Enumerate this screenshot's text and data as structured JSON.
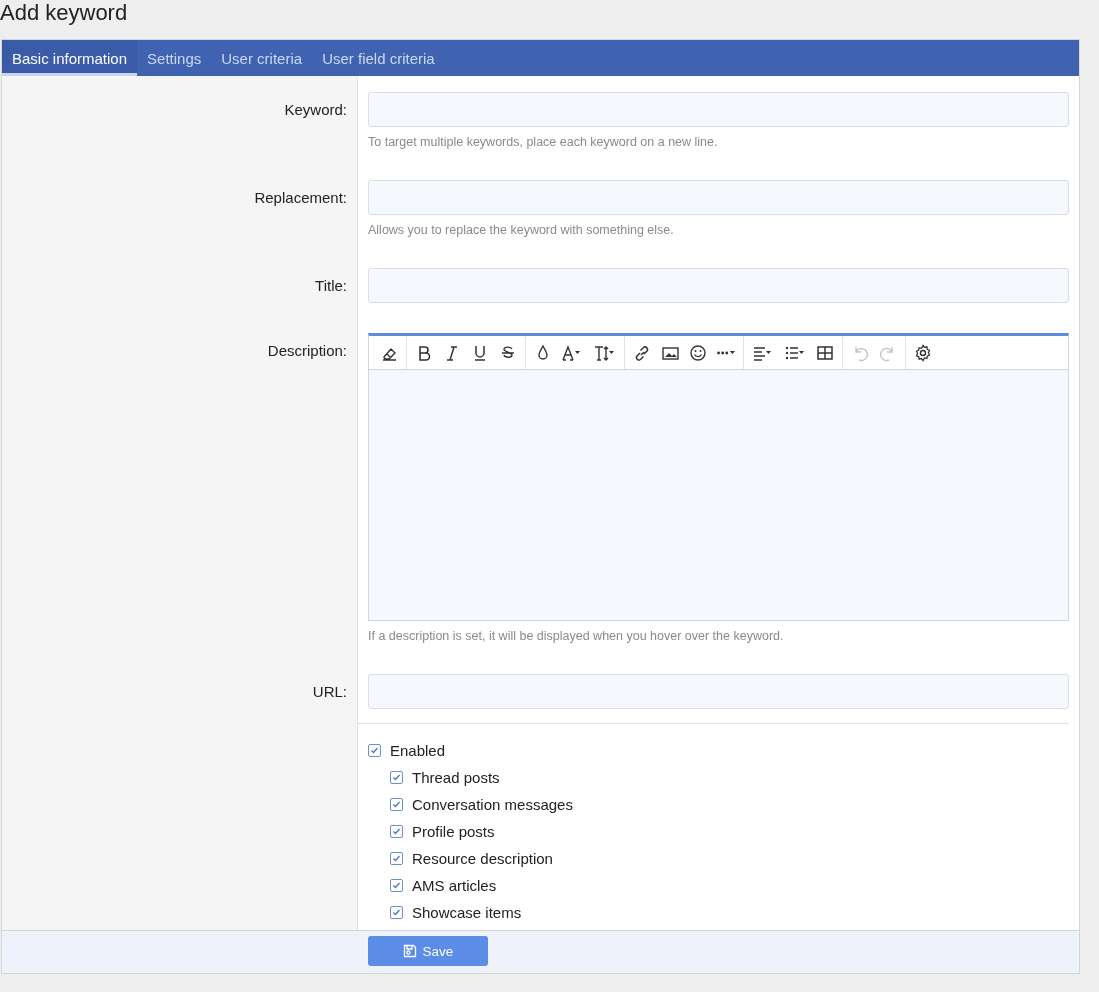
{
  "page_title": "Add keyword",
  "tabs": [
    {
      "label": "Basic information",
      "selected": true
    },
    {
      "label": "Settings",
      "selected": false
    },
    {
      "label": "User criteria",
      "selected": false
    },
    {
      "label": "User field criteria",
      "selected": false
    }
  ],
  "fields": [
    {
      "kind": "text",
      "label": "Keyword:",
      "hint": "To target multiple keywords, place each keyword on a new line."
    },
    {
      "kind": "text",
      "label": "Replacement:",
      "hint": "Allows you to replace the keyword with something else."
    },
    {
      "kind": "text",
      "label": "Title:"
    },
    {
      "kind": "editor",
      "label": "Description:",
      "hint": "If a description is set, it will be displayed when you hover over the keyword.",
      "toolbar": [
        [
          {
            "kind": "eraser",
            "disabled": false
          }
        ],
        [
          {
            "kind": "bold",
            "disabled": false
          },
          {
            "kind": "italic",
            "disabled": false
          },
          {
            "kind": "underline",
            "disabled": false
          },
          {
            "kind": "strike",
            "disabled": false
          }
        ],
        [
          {
            "kind": "color",
            "disabled": false
          },
          {
            "kind": "font",
            "disabled": false
          },
          {
            "kind": "size",
            "disabled": false
          }
        ],
        [
          {
            "kind": "link",
            "disabled": false
          },
          {
            "kind": "image",
            "disabled": false
          },
          {
            "kind": "smilie",
            "disabled": false
          },
          {
            "kind": "more",
            "disabled": false
          }
        ],
        [
          {
            "kind": "align",
            "disabled": false
          },
          {
            "kind": "list",
            "disabled": false
          },
          {
            "kind": "table",
            "disabled": false
          }
        ],
        [
          {
            "kind": "undo",
            "disabled": true
          },
          {
            "kind": "redo",
            "disabled": true
          }
        ],
        [
          {
            "kind": "gear",
            "disabled": false
          }
        ]
      ]
    },
    {
      "kind": "text",
      "label": "URL:"
    }
  ],
  "options": [
    {
      "label": "Enabled",
      "checked": true,
      "children": [
        {
          "label": "Thread posts",
          "checked": true
        },
        {
          "label": "Conversation messages",
          "checked": true
        },
        {
          "label": "Profile posts",
          "checked": true
        },
        {
          "label": "Resource description",
          "checked": true
        },
        {
          "label": "AMS articles",
          "checked": true
        },
        {
          "label": "Showcase items",
          "checked": true
        }
      ]
    }
  ],
  "save_button": "Save"
}
